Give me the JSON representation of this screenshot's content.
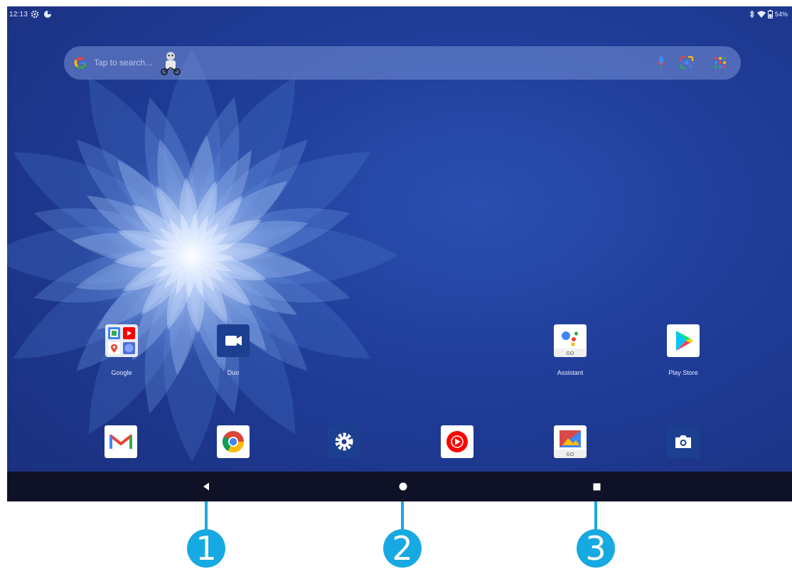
{
  "status_bar": {
    "time": "12:13",
    "left_icons": [
      "gear-icon",
      "vpn-icon"
    ],
    "right_icons": [
      "bluetooth-icon",
      "wifi-icon",
      "battery-icon"
    ],
    "battery": "54%"
  },
  "search": {
    "placeholder": "Tap to search..."
  },
  "home_apps": [
    {
      "id": "google",
      "label": "Google",
      "icon": "google-folder-icon"
    },
    {
      "id": "duo",
      "label": "Duo",
      "icon": "duo-icon"
    },
    {
      "id": "assistant",
      "label": "Assistant",
      "icon": "assistant-icon"
    },
    {
      "id": "play-store",
      "label": "Play Store",
      "icon": "play-store-icon"
    }
  ],
  "dock": [
    {
      "id": "gmail",
      "icon": "gmail-icon"
    },
    {
      "id": "chrome",
      "icon": "chrome-icon"
    },
    {
      "id": "settings",
      "icon": "settings-icon"
    },
    {
      "id": "youtube-music",
      "icon": "youtube-music-icon"
    },
    {
      "id": "gallery",
      "icon": "gallery-go-icon"
    },
    {
      "id": "camera",
      "icon": "camera-icon"
    }
  ],
  "nav": {
    "buttons": [
      "back-icon",
      "home-icon",
      "recents-icon"
    ]
  },
  "callouts": [
    "1",
    "2",
    "3"
  ],
  "colors": {
    "wallpaper": "#1f3c97",
    "nav_bar": "#0f1126",
    "callout": "#17a9e1"
  }
}
